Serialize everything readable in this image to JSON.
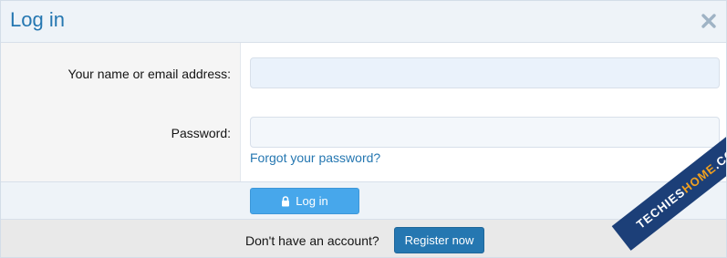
{
  "dialog": {
    "title": "Log in",
    "close_icon": "close-icon"
  },
  "form": {
    "name_label": "Your name or email address:",
    "name_value": "",
    "password_label": "Password:",
    "password_value": "",
    "forgot_link": "Forgot your password?"
  },
  "actions": {
    "login_label": "Log in",
    "login_icon": "lock-icon"
  },
  "footer": {
    "prompt": "Don't have an account?",
    "register_label": "Register now"
  },
  "watermark": {
    "part_a": "TECHIES",
    "part_b": "HOME",
    "part_c": ".COM"
  },
  "colors": {
    "accent": "#2577b1",
    "button_primary": "#47a7eb",
    "watermark_bg": "#1c3f78",
    "watermark_highlight": "#f0a020"
  }
}
